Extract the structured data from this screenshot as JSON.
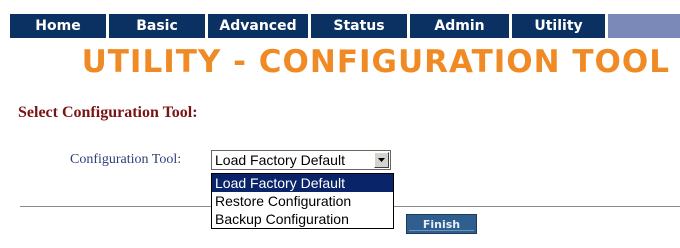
{
  "nav": {
    "tabs": [
      {
        "label": "Home"
      },
      {
        "label": "Basic"
      },
      {
        "label": "Advanced"
      },
      {
        "label": "Status"
      },
      {
        "label": "Admin"
      },
      {
        "label": "Utility"
      }
    ]
  },
  "page": {
    "title": "UTILITY - CONFIGURATION TOOL",
    "section_heading": "Select Configuration Tool:"
  },
  "form": {
    "field_label": "Configuration Tool:",
    "selected_value": "Load Factory Default",
    "options": [
      {
        "label": "Load Factory Default",
        "highlighted": true
      },
      {
        "label": "Restore Configuration",
        "highlighted": false
      },
      {
        "label": "Backup Configuration",
        "highlighted": false
      }
    ],
    "finish_label": "Finish"
  },
  "colors": {
    "nav_bg": "#0b3163",
    "title": "#f08a24",
    "heading": "#7a1414",
    "label": "#2c3f7a",
    "highlight": "#0a246a"
  }
}
